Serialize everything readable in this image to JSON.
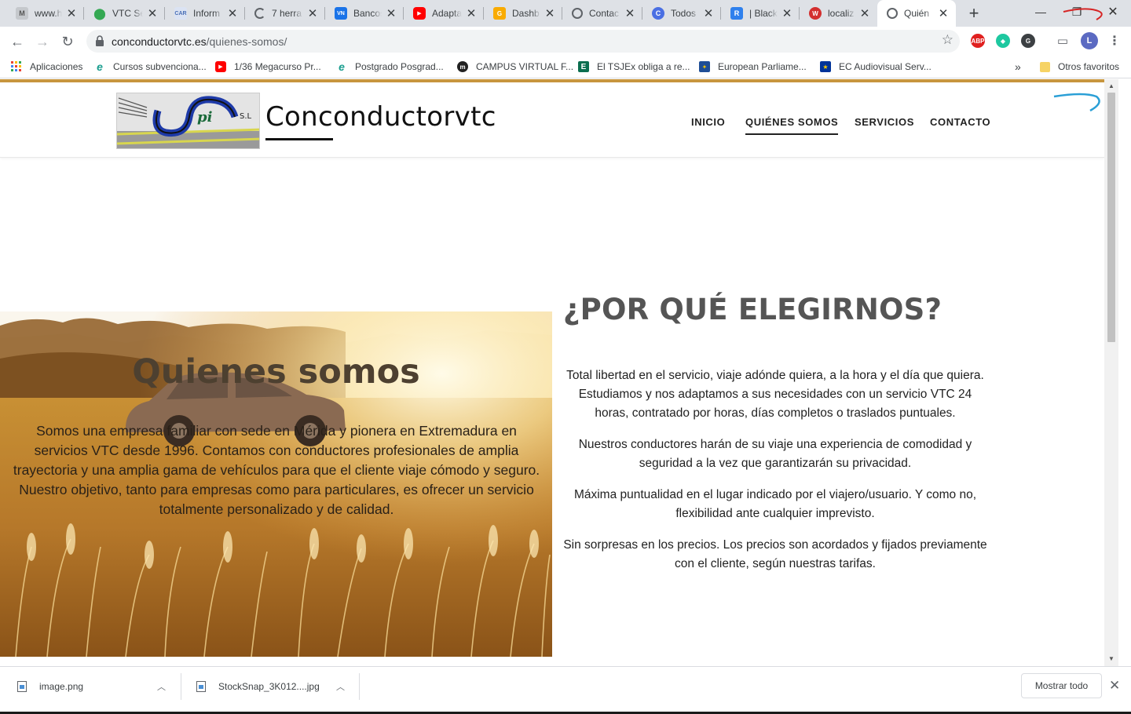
{
  "tabs": [
    {
      "title": "www.h",
      "icon": "gmail-icon",
      "color": "#9aa0a6"
    },
    {
      "title": "VTC Se",
      "icon": "maps-pin-icon",
      "color": "#34a853"
    },
    {
      "title": "Inform",
      "icon": "gir-car-icon",
      "color": "#4a6fb5"
    },
    {
      "title": "7 herra",
      "icon": "loading-spinner-icon",
      "color": "#5f6368"
    },
    {
      "title": "Bancos",
      "icon": "vn-icon",
      "color": "#1a73e8"
    },
    {
      "title": "Adapta",
      "icon": "youtube-icon",
      "color": "#ff0000"
    },
    {
      "title": "Dashb",
      "icon": "dashboard-icon",
      "color": "#f9ab00"
    },
    {
      "title": "Contac",
      "icon": "globe-icon",
      "color": "#5f6368"
    },
    {
      "title": "Todos",
      "icon": "c-icon",
      "color": "#4a6fe3"
    },
    {
      "title": "| Black",
      "icon": "r-icon",
      "color": "#2f80ed"
    },
    {
      "title": "localiz",
      "icon": "w-icon",
      "color": "#d32f2f"
    },
    {
      "title": "Quién",
      "icon": "globe-icon",
      "color": "#5f6368"
    }
  ],
  "browser": {
    "url_domain": "conconductorvtc.es",
    "url_path": "/quienes-somos/",
    "profile_initial": "L",
    "abp_label": "ABP"
  },
  "bookmarks": [
    {
      "label": "Aplicaciones",
      "icon": "apps-grid-icon",
      "color": "#ea4335"
    },
    {
      "label": "Cursos subvenciona...",
      "icon": "e-icon",
      "color": "#1a9e8f"
    },
    {
      "label": "1/36 Megacurso Pr...",
      "icon": "youtube-icon",
      "color": "#ff0000"
    },
    {
      "label": "Postgrado Posgrad...",
      "icon": "e-icon",
      "color": "#1a9e8f"
    },
    {
      "label": "CAMPUS VIRTUAL F...",
      "icon": "m-icon",
      "color": "#222222"
    },
    {
      "label": "El TSJEx obliga a re...",
      "icon": "e-box-icon",
      "color": "#0b6e4f"
    },
    {
      "label": "European Parliame...",
      "icon": "eu-parliament-icon",
      "color": "#1f4e96"
    },
    {
      "label": "EC Audiovisual Serv...",
      "icon": "eu-flag-icon",
      "color": "#003399"
    }
  ],
  "bookmarks_overflow": "»",
  "other_bookmarks": "Otros favoritos",
  "site": {
    "name": "Conconductorvtc",
    "logo_text": "S.L",
    "nav": [
      "INICIO",
      "QUIÉNES SOMOS",
      "SERVICIOS",
      "CONTACTO"
    ],
    "active_nav": "QUIÉNES SOMOS",
    "accent_color": "#c8963e"
  },
  "hero": {
    "title": "Quienes somos",
    "text": "Somos una empresa familiar con sede en Mérida y pionera en Extremadura en servicios VTC desde 1996. Contamos con conductores profesionales de amplia trayectoria y una amplia gama de vehículos para que el cliente viaje cómodo y seguro.  Nuestro objetivo, tanto para empresas como para particulares, es ofrecer un servicio totalmente personalizado y de calidad."
  },
  "why": {
    "title": "¿POR QUÉ ELEGIRNOS?",
    "paragraphs": [
      "Total libertad en el servicio, viaje adónde quiera, a la hora y el día que quiera. Estudiamos y nos adaptamos a sus necesidades con un servicio VTC 24 horas, contratado por horas, días completos o traslados puntuales.",
      "Nuestros conductores harán de su viaje una experiencia de comodidad y seguridad a la vez que garantizarán su privacidad.",
      "Máxima puntualidad en el lugar indicado por el viajero/usuario. Y como no, flexibilidad ante cualquier imprevisto.",
      "Sin sorpresas en los precios. Los precios son acordados y fijados previamente con el cliente, según nuestras tarifas."
    ]
  },
  "downloads": [
    {
      "name": "image.png"
    },
    {
      "name": "StockSnap_3K012....jpg"
    }
  ],
  "show_all": "Mostrar todo"
}
